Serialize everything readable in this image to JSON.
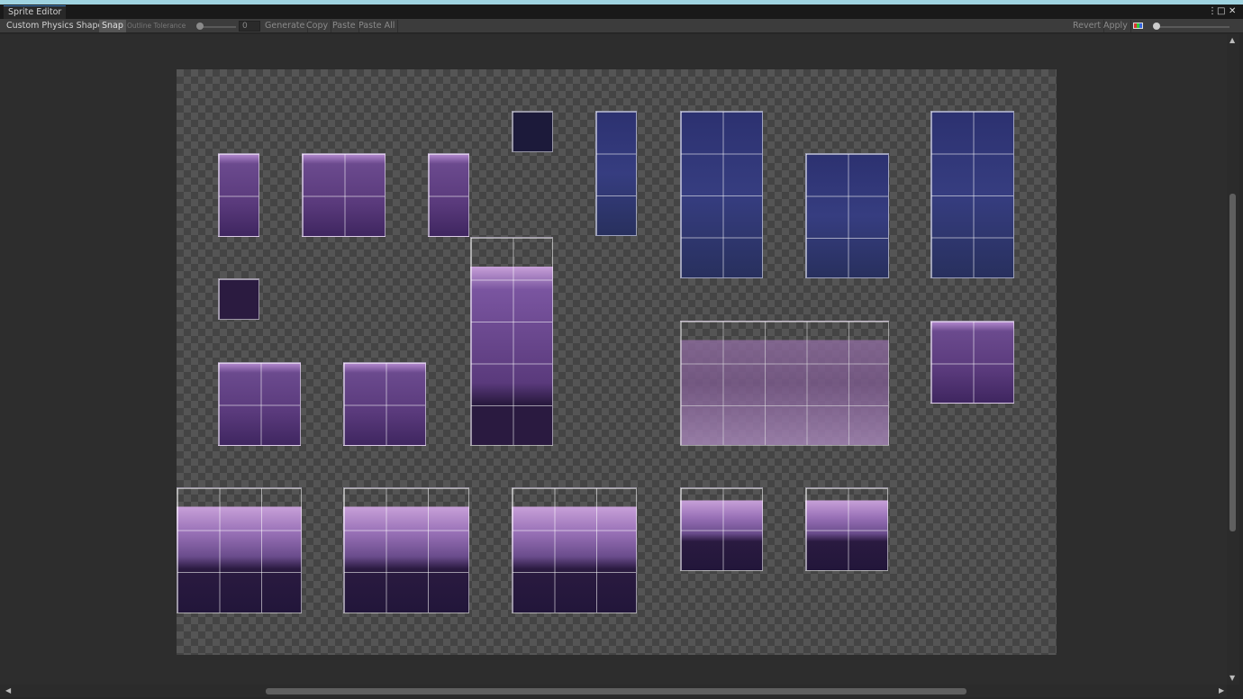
{
  "window": {
    "tab_title": "Sprite Editor"
  },
  "toolbar": {
    "mode": "Custom Physics Shape",
    "snap": "Snap",
    "outline_tolerance_label": "Outline Tolerance",
    "outline_tolerance_value": "0",
    "generate": "Generate",
    "copy": "Copy",
    "paste": "Paste",
    "paste_all": "Paste All",
    "revert": "Revert",
    "apply": "Apply"
  },
  "icons": {
    "menu": "kebab-icon",
    "maximize": "maximize-icon",
    "close": "close-icon",
    "color_channels": "rgb-icon",
    "zoom": "zoom-slider"
  },
  "colors": {
    "accent": "#3a79bb",
    "sprite_outline": "#ffffff"
  }
}
